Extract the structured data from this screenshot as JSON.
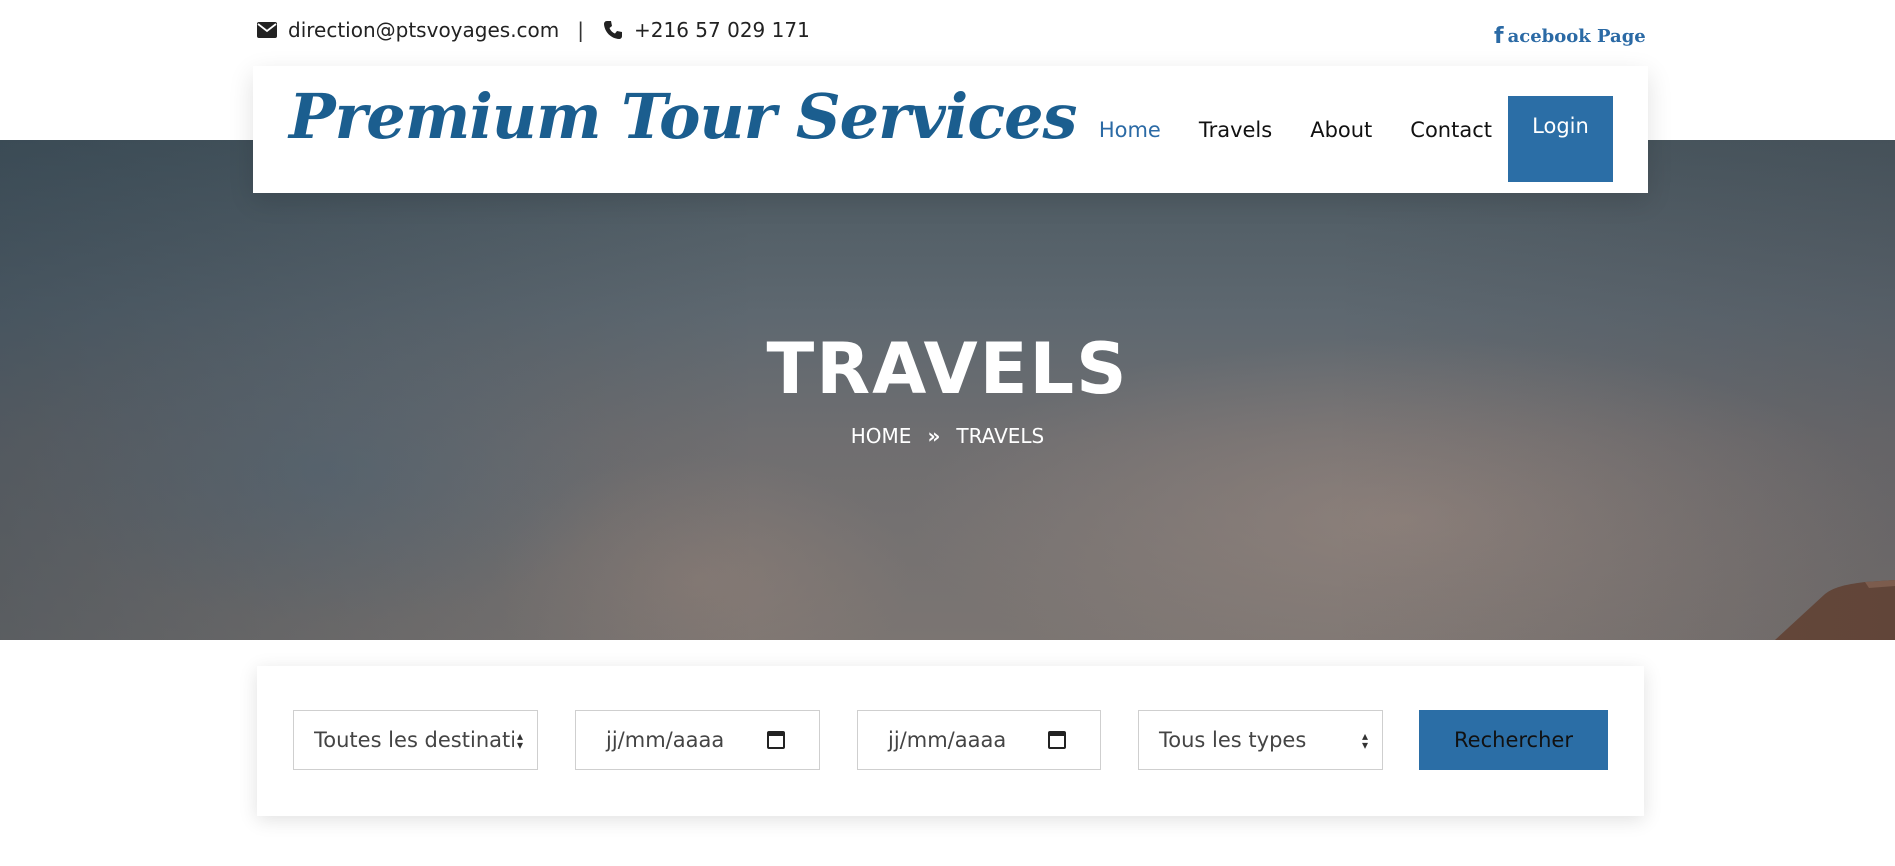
{
  "topbar": {
    "email": "direction@ptsvoyages.com",
    "separator": "|",
    "phone": "+216 57 029 171",
    "facebook_icon": "f",
    "facebook_label": "acebook Page"
  },
  "header": {
    "logo_text": "Premium Tour Services",
    "nav": [
      {
        "label": "Home",
        "active": true
      },
      {
        "label": "Travels",
        "active": false
      },
      {
        "label": "About",
        "active": false
      },
      {
        "label": "Contact",
        "active": false
      }
    ],
    "login_label": "Login"
  },
  "hero": {
    "title": "TRAVELS",
    "breadcrumb": [
      "HOME",
      "TRAVELS"
    ]
  },
  "search": {
    "destination_value": "Toutes les destinatio",
    "date_from_placeholder": "jj/mm/aaaa",
    "date_to_placeholder": "jj/mm/aaaa",
    "type_value": "Tous les types",
    "submit_label": "Rechercher"
  },
  "colors": {
    "accent": "#2b6ea6",
    "logo": "#1b5e8f",
    "nav_active": "#2b6aa5"
  }
}
